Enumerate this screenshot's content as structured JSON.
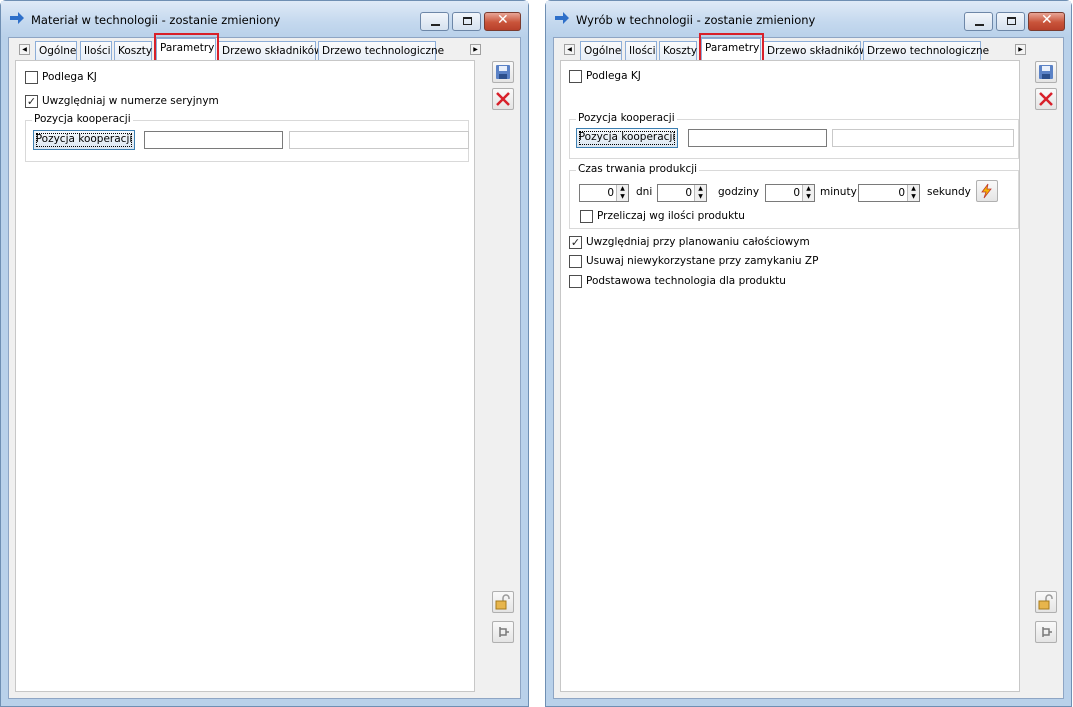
{
  "window1": {
    "title": "Materiał w technologii - zostanie zmieniony",
    "tabs": [
      "Ogólne",
      "Ilości",
      "Koszty",
      "Parametry",
      "Drzewo składników",
      "Drzewo technologiczne"
    ],
    "active_tab": "Parametry",
    "checkboxes": [
      {
        "label": "Podlega KJ",
        "checked": false
      },
      {
        "label": "Uwzględniaj w numerze seryjnym",
        "checked": true
      }
    ],
    "cooperation_group": {
      "title": "Pozycja kooperacji",
      "button": "Pozycja kooperacji",
      "field1": "",
      "field2": ""
    }
  },
  "window2": {
    "title": "Wyrób w technologii - zostanie zmieniony",
    "tabs": [
      "Ogólne",
      "Ilości",
      "Koszty",
      "Parametry",
      "Drzewo składników",
      "Drzewo technologiczne"
    ],
    "active_tab": "Parametry",
    "checkboxes_top": [
      {
        "label": "Podlega KJ",
        "checked": false
      }
    ],
    "cooperation_group": {
      "title": "Pozycja kooperacji",
      "button": "Pozycja kooperacji",
      "field1": "",
      "field2": ""
    },
    "duration_group": {
      "title": "Czas trwania produkcji",
      "fields": [
        {
          "value": "0",
          "unit": "dni"
        },
        {
          "value": "0",
          "unit": "godziny"
        },
        {
          "value": "0",
          "unit": "minuty"
        },
        {
          "value": "0",
          "unit": "sekundy"
        }
      ],
      "recalc": {
        "label": "Przeliczaj wg ilości produktu",
        "checked": false
      }
    },
    "checkboxes_bottom": [
      {
        "label": "Uwzględniaj przy planowaniu całościowym",
        "checked": true
      },
      {
        "label": "Usuwaj niewykorzystane przy zamykaniu ZP",
        "checked": false
      },
      {
        "label": "Podstawowa technologia dla produktu",
        "checked": false
      }
    ]
  },
  "icons": {
    "title": "arrow-right-icon",
    "save": "save-icon",
    "cancel": "cancel-icon",
    "lock": "lock-icon",
    "pin": "pin-icon",
    "lightning": "lightning-icon"
  },
  "colors": {
    "highlight": "#d8202a",
    "frame": "#b9d1ea",
    "tab_border": "#8daed8"
  }
}
